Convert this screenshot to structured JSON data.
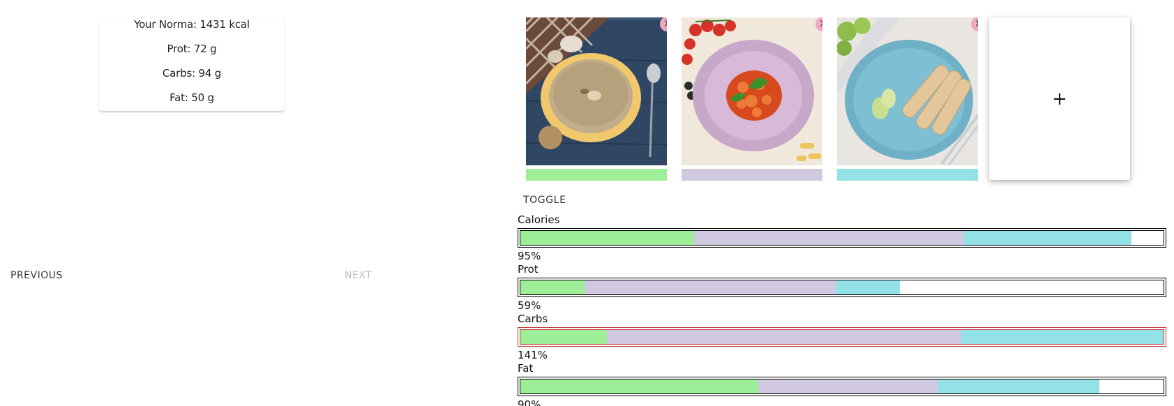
{
  "summary": {
    "norma": "Your Norma: 1431 kcal",
    "prot": "Prot: 72 g",
    "carbs": "Carbs: 94 g",
    "fat": "Fat: 50 g"
  },
  "nav": {
    "previous": "PREVIOUS",
    "next": "NEXT"
  },
  "foods": [
    {
      "name": "mushroom-soup",
      "color": "#9eee98",
      "remove": "X"
    },
    {
      "name": "pasta",
      "color": "#d1c9df",
      "remove": "X"
    },
    {
      "name": "spring-rolls",
      "color": "#93e2e8",
      "remove": "X"
    }
  ],
  "add_label": "+",
  "toggle_label": "TOGGLE",
  "metrics": [
    {
      "label": "Calories",
      "pct": "95%",
      "over": false,
      "segments": [
        0.27,
        0.42,
        0.26
      ]
    },
    {
      "label": "Prot",
      "pct": "59%",
      "over": false,
      "segments": [
        0.1,
        0.39,
        0.1
      ]
    },
    {
      "label": "Carbs",
      "pct": "141%",
      "over": true,
      "segments": [
        0.134,
        0.552,
        0.314
      ]
    },
    {
      "label": "Fat",
      "pct": "90%",
      "over": false,
      "segments": [
        0.37,
        0.28,
        0.25
      ]
    }
  ]
}
